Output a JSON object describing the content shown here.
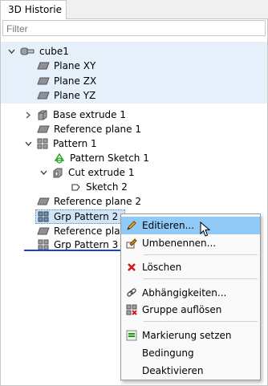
{
  "panel": {
    "tab_title": "3D Historie",
    "filter_placeholder": "Filter"
  },
  "tree": {
    "root": {
      "label": "cube1"
    },
    "planes": [
      "Plane XY",
      "Plane ZX",
      "Plane YZ"
    ],
    "items": {
      "base_extrude": "Base extrude 1",
      "reference_plane_1": "Reference plane 1",
      "pattern_1": "Pattern 1",
      "pattern_sketch_1": "Pattern Sketch 1",
      "cut_extrude_1": "Cut extrude 1",
      "sketch_2": "Sketch 2",
      "reference_plane_2": "Reference plane 2",
      "grp_pattern_2": "Grp Pattern 2",
      "reference_plane_3": "Reference plane",
      "grp_pattern_3": "Grp Pattern 3"
    }
  },
  "context_menu": {
    "edit": "Editieren...",
    "rename": "Umbenennen...",
    "delete": "Löschen",
    "dependencies": "Abhängigkeiten...",
    "ungroup": "Gruppe auflösen",
    "set_marker": "Markierung setzen",
    "condition": "Bedingung",
    "deactivate": "Deaktivieren"
  },
  "colors": {
    "selection": "#cfe4f7",
    "menu_highlight": "#91c9f7",
    "insert_line": "#1e3fd0",
    "root_band": "#e6f0fa"
  }
}
